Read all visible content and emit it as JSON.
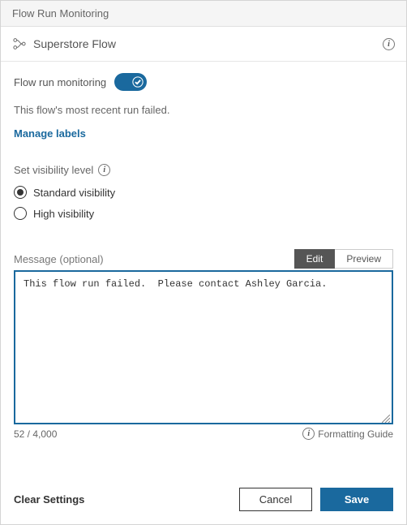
{
  "header": {
    "title": "Flow Run Monitoring"
  },
  "subheader": {
    "flow_name": "Superstore Flow"
  },
  "monitoring": {
    "label": "Flow run monitoring",
    "enabled": true,
    "status_text": "This flow's most recent run failed.",
    "manage_labels": "Manage labels"
  },
  "visibility": {
    "label": "Set visibility level",
    "options": [
      {
        "label": "Standard visibility",
        "selected": true
      },
      {
        "label": "High visibility",
        "selected": false
      }
    ]
  },
  "message": {
    "label": "Message (optional)",
    "tabs": {
      "edit": "Edit",
      "preview": "Preview",
      "active": "edit"
    },
    "value": "This flow run failed.  Please contact Ashley Garcia.",
    "counter": "52 / 4,000",
    "formatting_guide": "Formatting Guide"
  },
  "footer": {
    "clear": "Clear Settings",
    "cancel": "Cancel",
    "save": "Save"
  }
}
